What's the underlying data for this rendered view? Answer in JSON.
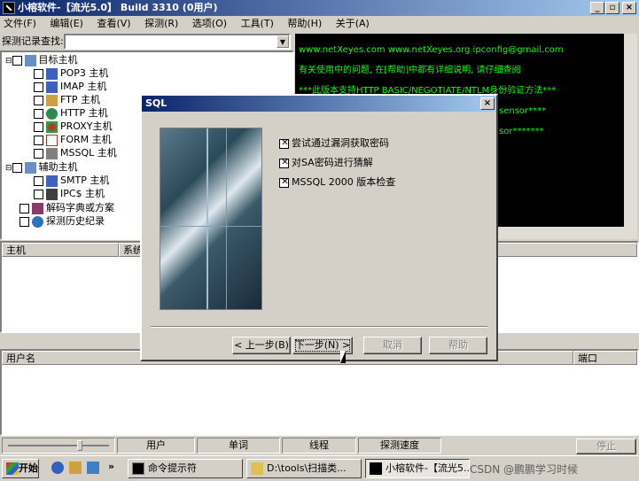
{
  "app": {
    "title": "小榕软件-【流光5.0】 Build 3310 (0用户)",
    "btn_min": "_",
    "btn_max": "▫",
    "btn_close": "×"
  },
  "menu": [
    "文件(F)",
    "编辑(E)",
    "查看(V)",
    "探测(R)",
    "选项(O)",
    "工具(T)",
    "帮助(H)",
    "关于(A)"
  ],
  "search": {
    "label": "探测记录查找:",
    "value": ""
  },
  "tree": {
    "root": "目标主机",
    "hosts": [
      "POP3 主机",
      "IMAP 主机",
      "FTP 主机",
      "HTTP 主机",
      "PROXY主机",
      "FORM 主机",
      "MSSQL 主机"
    ],
    "aux": "辅助主机",
    "aux_items": [
      "SMTP 主机",
      "IPC$ 主机"
    ],
    "dict": "解码字典或方案",
    "history": "探测历史纪录"
  },
  "terminal": [
    "www.netXeyes.com www.netXeyes.org ipconfig@gmail.com",
    "有关使用中的问题, 在[帮助]中都有详细说明, 请仔细查阅",
    "***此版本支持HTTP BASIC/NEGOTIATE/NTLM身份验证方法***",
    "sensor****",
    "sor*******"
  ],
  "hosts_table": {
    "columns": [
      "主机",
      "系统"
    ]
  },
  "users_table": {
    "columns": [
      "用户名",
      "端口"
    ]
  },
  "dialog": {
    "title": "SQL",
    "close": "×",
    "options": [
      "尝试通过漏洞获取密码",
      "对SA密码进行猜解",
      "MSSQL 2000 版本检查"
    ],
    "prev": "< 上一步(B)",
    "next": "下一步(N) >",
    "cancel": "取消",
    "help": "帮助"
  },
  "statusbar": {
    "user": "用户",
    "word": "单词",
    "thread": "线程",
    "speed": "探测速度",
    "stop": "停止"
  },
  "taskbar": {
    "start": "开始",
    "tasks": [
      "命令提示符",
      "D:\\tools\\扫描类...",
      "小榕软件-【流光5...."
    ],
    "watermark": "CSDN @鹏鹏学习时候"
  },
  "colors": {
    "title": "#0a246a",
    "face": "#d4d0c8",
    "term_text": "#00ff00"
  }
}
